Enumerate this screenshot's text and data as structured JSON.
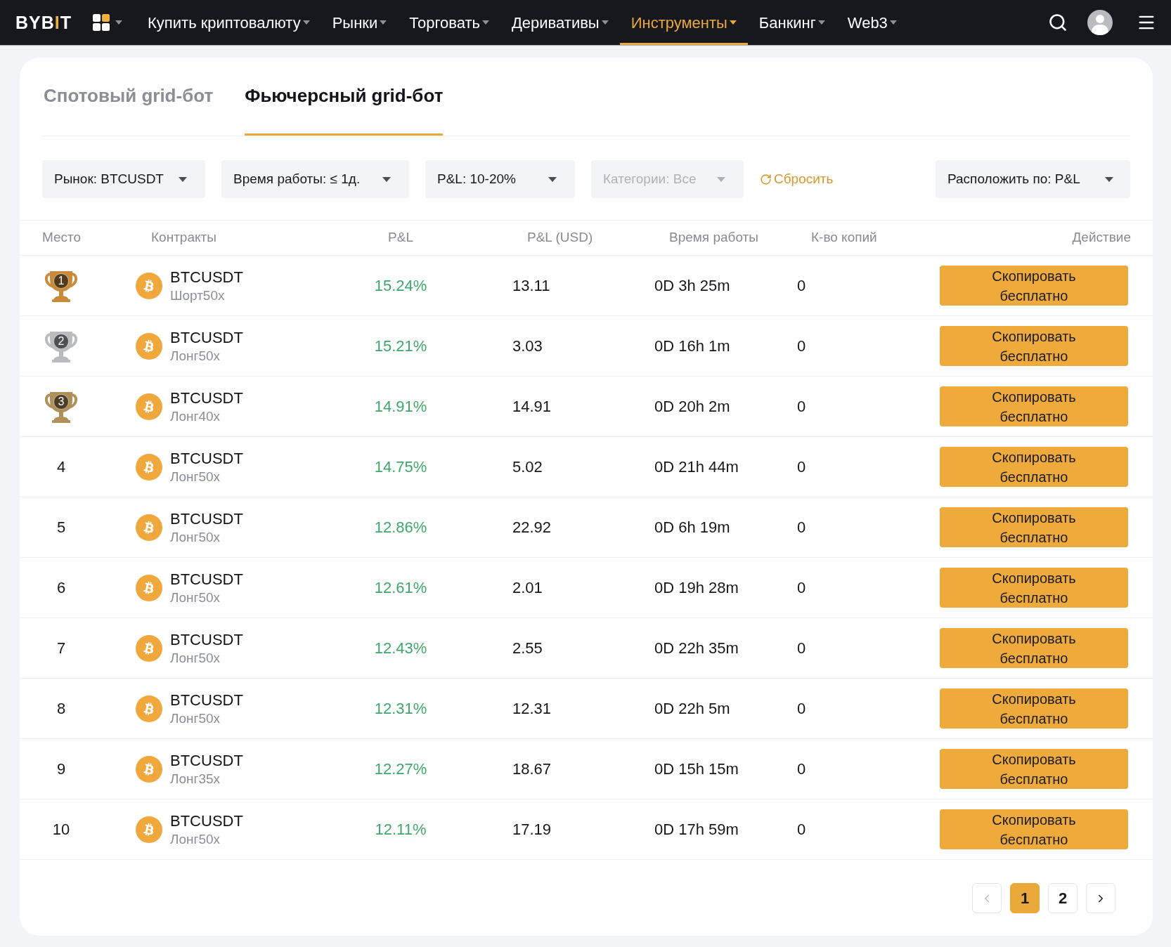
{
  "header": {
    "logo": "BYBIT",
    "nav": [
      {
        "label": "Купить криптовалюту",
        "selected": false
      },
      {
        "label": "Рынки",
        "selected": false
      },
      {
        "label": "Торговать",
        "selected": false
      },
      {
        "label": "Деривативы",
        "selected": false
      },
      {
        "label": "Инструменты",
        "selected": true
      },
      {
        "label": "Банкинг",
        "selected": false
      },
      {
        "label": "Web3",
        "selected": false
      }
    ]
  },
  "tabs": [
    {
      "label": "Спотовый grid-бот",
      "selected": false
    },
    {
      "label": "Фьючерсный grid-бот",
      "selected": true
    }
  ],
  "filters": [
    {
      "label": "Рынок: BTCUSDT",
      "disabled": false
    },
    {
      "label": "Время работы: ≤ 1д.",
      "disabled": false
    },
    {
      "label": "P&L: 10-20%",
      "disabled": false
    },
    {
      "label": "Категории: Все",
      "disabled": true
    }
  ],
  "reset": "Сбросить",
  "sort": {
    "label": "Расположить по: P&L"
  },
  "table": {
    "columns": [
      "Место",
      "Контракты",
      "P&L",
      "P&L (USD)",
      "Время работы",
      "К-во копий",
      "Действие"
    ],
    "rows": [
      {
        "rank": "1",
        "kind": "trophy",
        "color": "#c98a3c",
        "contract": "BTCUSDT",
        "mode": "Шорт50x",
        "pnl": "15.24%",
        "pnl_usd": "13.11",
        "runtime": "0D 3h 25m",
        "copies": "0",
        "action": "Скопировать бесплатно"
      },
      {
        "rank": "2",
        "kind": "trophy",
        "color": "#b9bbbe",
        "contract": "BTCUSDT",
        "mode": "Лонг50x",
        "pnl": "15.21%",
        "pnl_usd": "3.03",
        "runtime": "0D 16h 1m",
        "copies": "0",
        "action": "Скопировать бесплатно"
      },
      {
        "rank": "3",
        "kind": "trophy",
        "color": "#b09058",
        "contract": "BTCUSDT",
        "mode": "Лонг40x",
        "pnl": "14.91%",
        "pnl_usd": "14.91",
        "runtime": "0D 20h 2m",
        "copies": "0",
        "action": "Скопировать бесплатно"
      },
      {
        "rank": "4",
        "kind": "plain",
        "contract": "BTCUSDT",
        "mode": "Лонг50x",
        "pnl": "14.75%",
        "pnl_usd": "5.02",
        "runtime": "0D 21h 44m",
        "copies": "0",
        "action": "Скопировать бесплатно"
      },
      {
        "rank": "5",
        "kind": "plain",
        "contract": "BTCUSDT",
        "mode": "Лонг50x",
        "pnl": "12.86%",
        "pnl_usd": "22.92",
        "runtime": "0D 6h 19m",
        "copies": "0",
        "action": "Скопировать бесплатно"
      },
      {
        "rank": "6",
        "kind": "plain",
        "contract": "BTCUSDT",
        "mode": "Лонг50x",
        "pnl": "12.61%",
        "pnl_usd": "2.01",
        "runtime": "0D 19h 28m",
        "copies": "0",
        "action": "Скопировать бесплатно"
      },
      {
        "rank": "7",
        "kind": "plain",
        "contract": "BTCUSDT",
        "mode": "Лонг50x",
        "pnl": "12.43%",
        "pnl_usd": "2.55",
        "runtime": "0D 22h 35m",
        "copies": "0",
        "action": "Скопировать бесплатно"
      },
      {
        "rank": "8",
        "kind": "plain",
        "contract": "BTCUSDT",
        "mode": "Лонг50x",
        "pnl": "12.31%",
        "pnl_usd": "12.31",
        "runtime": "0D 22h 5m",
        "copies": "0",
        "action": "Скопировать бесплатно"
      },
      {
        "rank": "9",
        "kind": "plain",
        "contract": "BTCUSDT",
        "mode": "Лонг35x",
        "pnl": "12.27%",
        "pnl_usd": "18.67",
        "runtime": "0D 15h 15m",
        "copies": "0",
        "action": "Скопировать бесплатно"
      },
      {
        "rank": "10",
        "kind": "plain",
        "contract": "BTCUSDT",
        "mode": "Лонг50x",
        "pnl": "12.11%",
        "pnl_usd": "17.19",
        "runtime": "0D 17h 59m",
        "copies": "0",
        "action": "Скопировать бесплатно"
      }
    ]
  },
  "pagination": {
    "prev": {
      "disabled": true
    },
    "pages": [
      {
        "label": "1",
        "selected": true
      },
      {
        "label": "2",
        "selected": false
      }
    ],
    "next": {
      "disabled": false
    }
  }
}
